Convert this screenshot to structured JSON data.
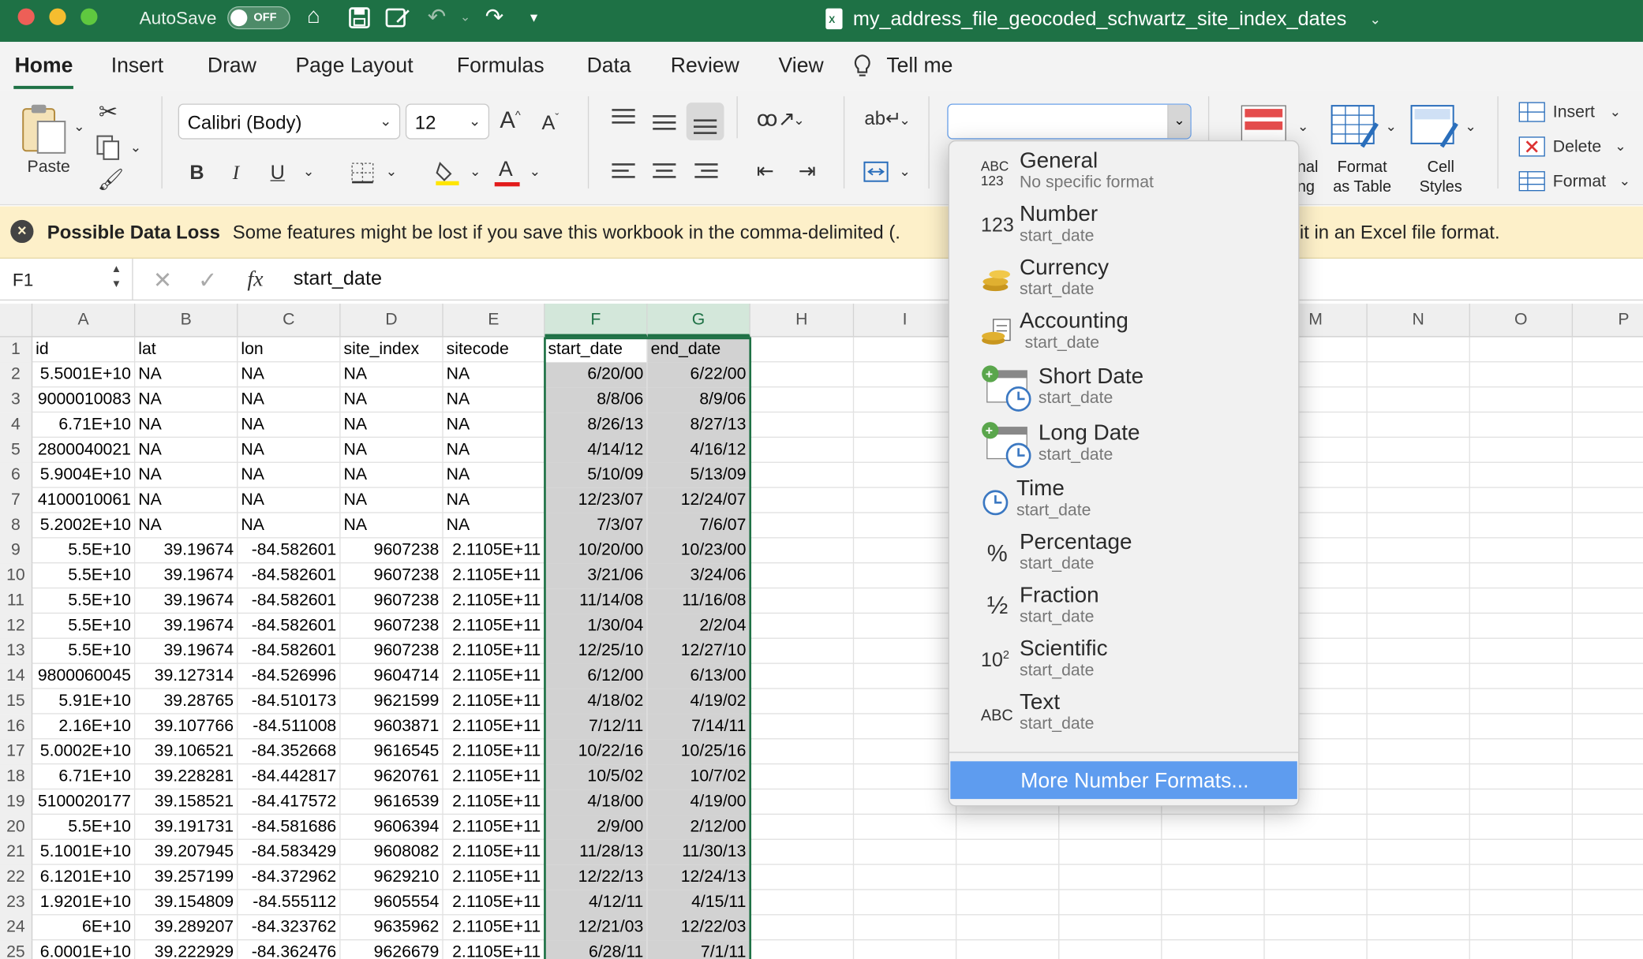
{
  "titlebar": {
    "autosave_label": "AutoSave",
    "autosave_state": "OFF",
    "filename": "my_address_file_geocoded_schwartz_site_index_dates"
  },
  "menu": [
    "Home",
    "Insert",
    "Draw",
    "Page Layout",
    "Formulas",
    "Data",
    "Review",
    "View",
    "Tell me"
  ],
  "ribbon": {
    "paste_label": "Paste",
    "font_name": "Calibri (Body)",
    "font_size": "12",
    "bold": "B",
    "italic": "I",
    "underline": "U",
    "number_format_value": "",
    "conditional_partial_1": "nal",
    "conditional_partial_2": "ng",
    "format_as_table_1": "Format",
    "format_as_table_2": "as Table",
    "cell_styles_1": "Cell",
    "cell_styles_2": "Styles",
    "insert_label": "Insert",
    "delete_label": "Delete",
    "format_label": "Format"
  },
  "message": {
    "title": "Possible Data Loss",
    "text_left": "Some features might be lost if you save this workbook in the comma-delimited (.",
    "text_right": ", save it in an Excel file format."
  },
  "formula_bar": {
    "cell_ref": "F1",
    "fx": "fx",
    "content": "start_date"
  },
  "columns": [
    "A",
    "B",
    "C",
    "D",
    "E",
    "F",
    "G",
    "H",
    "I",
    "",
    "",
    "",
    "M",
    "N",
    "O",
    "P"
  ],
  "headers": [
    "id",
    "lat",
    "lon",
    "site_index",
    "sitecode",
    "start_date",
    "end_date"
  ],
  "rows": [
    [
      "2",
      "5.5001E+10",
      "NA",
      "NA",
      "NA",
      "NA",
      "6/20/00",
      "6/22/00"
    ],
    [
      "3",
      "9000010083",
      "NA",
      "NA",
      "NA",
      "NA",
      "8/8/06",
      "8/9/06"
    ],
    [
      "4",
      "6.71E+10",
      "NA",
      "NA",
      "NA",
      "NA",
      "8/26/13",
      "8/27/13"
    ],
    [
      "5",
      "2800040021",
      "NA",
      "NA",
      "NA",
      "NA",
      "4/14/12",
      "4/16/12"
    ],
    [
      "6",
      "5.9004E+10",
      "NA",
      "NA",
      "NA",
      "NA",
      "5/10/09",
      "5/13/09"
    ],
    [
      "7",
      "4100010061",
      "NA",
      "NA",
      "NA",
      "NA",
      "12/23/07",
      "12/24/07"
    ],
    [
      "8",
      "5.2002E+10",
      "NA",
      "NA",
      "NA",
      "NA",
      "7/3/07",
      "7/6/07"
    ],
    [
      "9",
      "5.5E+10",
      "39.19674",
      "-84.582601",
      "9607238",
      "2.1105E+11",
      "10/20/00",
      "10/23/00"
    ],
    [
      "10",
      "5.5E+10",
      "39.19674",
      "-84.582601",
      "9607238",
      "2.1105E+11",
      "3/21/06",
      "3/24/06"
    ],
    [
      "11",
      "5.5E+10",
      "39.19674",
      "-84.582601",
      "9607238",
      "2.1105E+11",
      "11/14/08",
      "11/16/08"
    ],
    [
      "12",
      "5.5E+10",
      "39.19674",
      "-84.582601",
      "9607238",
      "2.1105E+11",
      "1/30/04",
      "2/2/04"
    ],
    [
      "13",
      "5.5E+10",
      "39.19674",
      "-84.582601",
      "9607238",
      "2.1105E+11",
      "12/25/10",
      "12/27/10"
    ],
    [
      "14",
      "9800060045",
      "39.127314",
      "-84.526996",
      "9604714",
      "2.1105E+11",
      "6/12/00",
      "6/13/00"
    ],
    [
      "15",
      "5.91E+10",
      "39.28765",
      "-84.510173",
      "9621599",
      "2.1105E+11",
      "4/18/02",
      "4/19/02"
    ],
    [
      "16",
      "2.16E+10",
      "39.107766",
      "-84.511008",
      "9603871",
      "2.1105E+11",
      "7/12/11",
      "7/14/11"
    ],
    [
      "17",
      "5.0002E+10",
      "39.106521",
      "-84.352668",
      "9616545",
      "2.1105E+11",
      "10/22/16",
      "10/25/16"
    ],
    [
      "18",
      "6.71E+10",
      "39.228281",
      "-84.442817",
      "9620761",
      "2.1105E+11",
      "10/5/02",
      "10/7/02"
    ],
    [
      "19",
      "5100020177",
      "39.158521",
      "-84.417572",
      "9616539",
      "2.1105E+11",
      "4/18/00",
      "4/19/00"
    ],
    [
      "20",
      "5.5E+10",
      "39.191731",
      "-84.581686",
      "9606394",
      "2.1105E+11",
      "2/9/00",
      "2/12/00"
    ],
    [
      "21",
      "5.1001E+10",
      "39.207945",
      "-84.583429",
      "9608082",
      "2.1105E+11",
      "11/28/13",
      "11/30/13"
    ],
    [
      "22",
      "6.1201E+10",
      "39.257199",
      "-84.372962",
      "9629210",
      "2.1105E+11",
      "12/22/13",
      "12/24/13"
    ],
    [
      "23",
      "1.9201E+10",
      "39.154809",
      "-84.555112",
      "9605554",
      "2.1105E+11",
      "4/12/11",
      "4/15/11"
    ],
    [
      "24",
      "6E+10",
      "39.289207",
      "-84.323762",
      "9635962",
      "2.1105E+11",
      "12/21/03",
      "12/22/03"
    ],
    [
      "25",
      "6.0001E+10",
      "39.222929",
      "-84.362476",
      "9626679",
      "2.1105E+11",
      "6/28/11",
      "7/1/11"
    ]
  ],
  "number_format_menu": {
    "items": [
      {
        "icon": "ABC 123",
        "name": "General",
        "sub": "No specific format"
      },
      {
        "icon": "123",
        "name": "Number",
        "sub": "start_date"
      },
      {
        "icon": "coins",
        "name": "Currency",
        "sub": "start_date"
      },
      {
        "icon": "coins-ledger",
        "name": "Accounting",
        "sub": "start_date"
      },
      {
        "icon": "calendar-clock",
        "name": "Short Date",
        "sub": "start_date"
      },
      {
        "icon": "calendar-clock",
        "name": "Long Date",
        "sub": "start_date"
      },
      {
        "icon": "clock",
        "name": "Time",
        "sub": "start_date"
      },
      {
        "icon": "%",
        "name": "Percentage",
        "sub": "start_date"
      },
      {
        "icon": "1/2",
        "name": "Fraction",
        "sub": "start_date"
      },
      {
        "icon": "10²",
        "name": "Scientific",
        "sub": "start_date"
      },
      {
        "icon": "ABC",
        "name": "Text",
        "sub": "start_date"
      }
    ],
    "more": "More Number Formats..."
  }
}
